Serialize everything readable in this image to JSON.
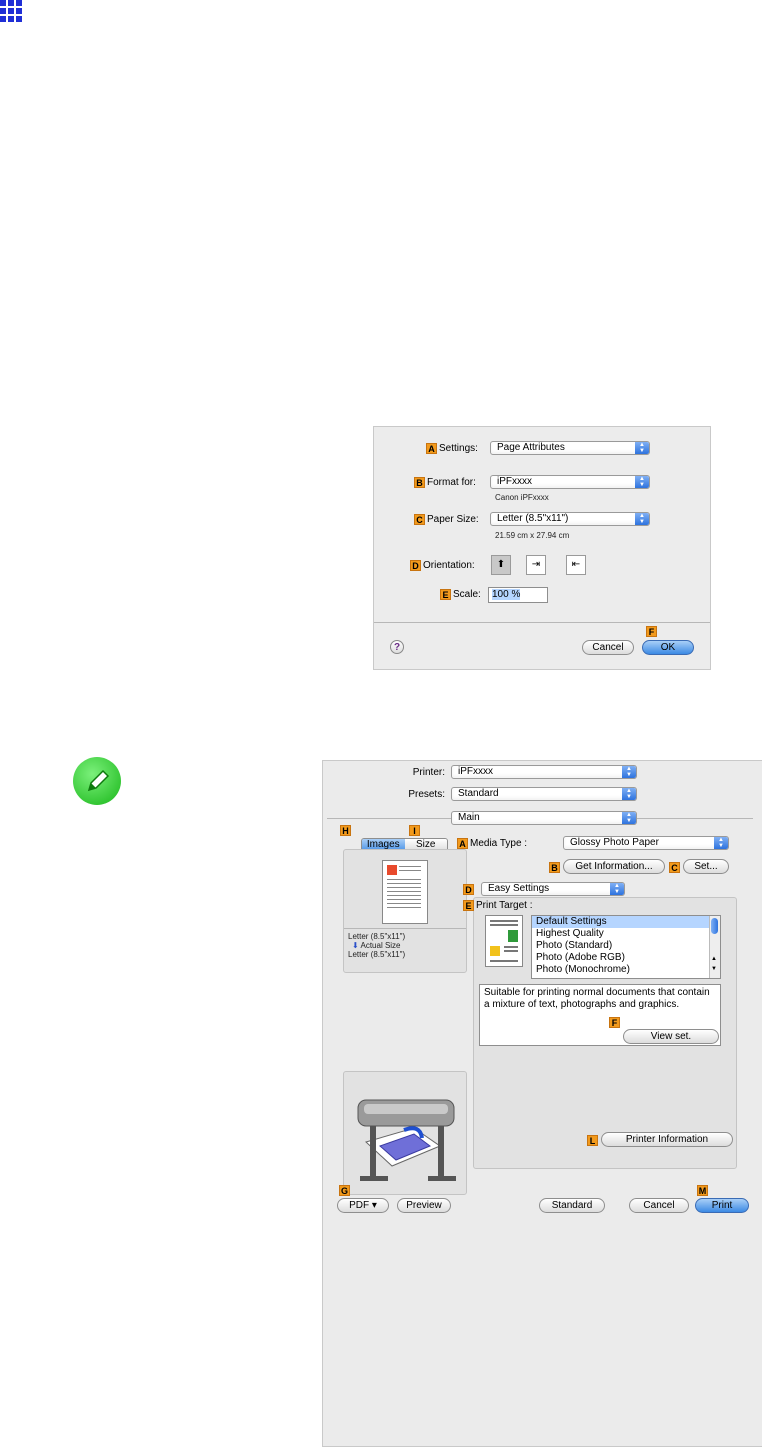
{
  "page_icons": {
    "grid": "grid-icon",
    "note": "pencil-note-icon"
  },
  "dialog1": {
    "settings_label": "Settings",
    "settings_value": "Page Attributes",
    "format_label": "Format for:",
    "format_value": "iPFxxxx",
    "format_sub": "Canon iPFxxxx",
    "paper_label": "Paper Size:",
    "paper_value": "Letter (8.5\"x11\")",
    "paper_sub": "21.59 cm x 27.94 cm",
    "orientation_label": "Orientation:",
    "scale_label": "Scale:",
    "scale_value": "100 %",
    "help_glyph": "?",
    "cancel": "Cancel",
    "ok": "OK",
    "badges": {
      "a": "A",
      "b": "B",
      "c": "C",
      "d": "D",
      "e": "E",
      "f": "F"
    }
  },
  "dialog2": {
    "printer_label": "Printer:",
    "printer_value": "iPFxxxx",
    "presets_label": "Presets:",
    "presets_value": "Standard",
    "panel_value": "Main",
    "tabs": [
      "Images",
      "Size"
    ],
    "media_label": "Media Type :",
    "media_value": "Glossy Photo Paper",
    "get_info": "Get Information...",
    "set": "Set...",
    "mode_value": "Easy Settings",
    "print_target_label": "Print Target :",
    "targets": [
      "Default Settings",
      "Highest Quality",
      "Photo (Standard)",
      "Photo (Adobe RGB)",
      "Photo (Monochrome)"
    ],
    "description": "Suitable for printing normal documents that contain a mixture of text, photographs and graphics.",
    "view_set": "View set.",
    "printer_info": "Printer Information",
    "preview_text_1": "Letter (8.5\"x11\")",
    "preview_text_2": "Actual Size",
    "preview_text_3": "Letter (8.5\"x11\")",
    "pdf": "PDF ▾",
    "preview": "Preview",
    "standard": "Standard",
    "cancel": "Cancel",
    "print": "Print",
    "badges": {
      "h": "H",
      "i": "I",
      "a": "A",
      "b": "B",
      "c": "C",
      "d": "D",
      "e": "E",
      "f": "F",
      "l": "L",
      "g": "G",
      "m": "M"
    }
  },
  "colors": {
    "badge": "#f29a1c",
    "accent": "#3c8ae4",
    "grid_icon": "#1f2fd6",
    "note_icon": "#18b618"
  }
}
